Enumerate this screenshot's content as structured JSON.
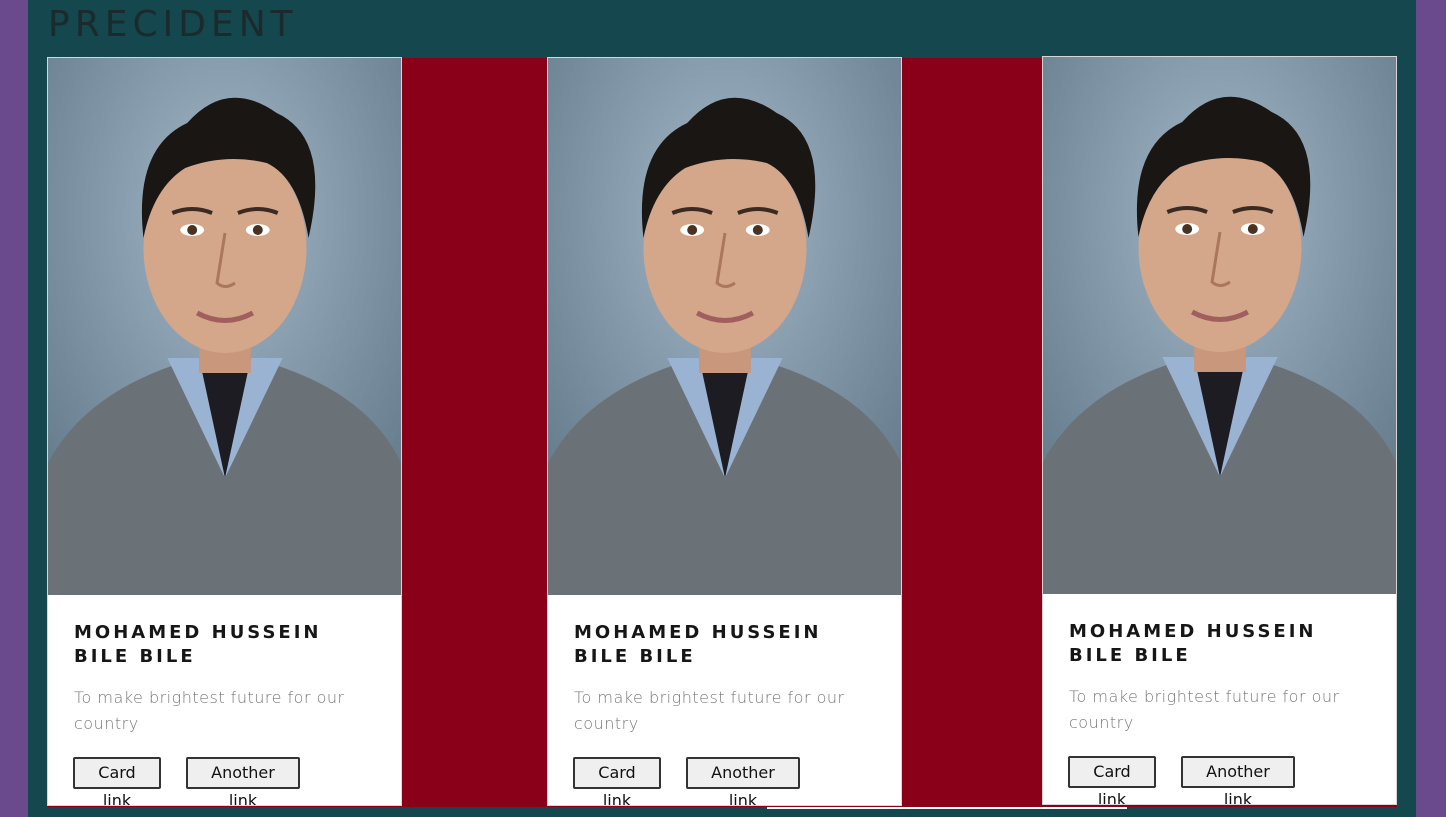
{
  "page": {
    "title": "PRECIDENT",
    "colors": {
      "outer": "#6a4a8c",
      "panel": "#14474e",
      "strip": "#8a0018",
      "card": "#ffffff"
    }
  },
  "cards": [
    {
      "photo": "portrait-photo",
      "name": "MOHAMED HUSSEIN BILE BILE",
      "description": "To make brightest future for our country",
      "link1": "Card link",
      "link2": "Another link"
    },
    {
      "photo": "portrait-photo",
      "name": "MOHAMED HUSSEIN BILE BILE",
      "description": "To make brightest future for our country",
      "link1": "Card link",
      "link2": "Another link"
    },
    {
      "photo": "portrait-photo",
      "name": "MOHAMED HUSSEIN BILE BILE",
      "description": "To make brightest future for our country",
      "link1": "Card link",
      "link2": "Another link"
    }
  ]
}
